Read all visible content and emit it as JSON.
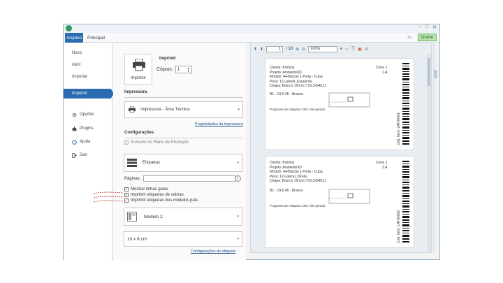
{
  "window": {
    "controls": [
      "–",
      "□",
      "✕"
    ]
  },
  "tabs": {
    "file_label": "Arquivo",
    "main_label": "Principal"
  },
  "status": {
    "online_label": "Online"
  },
  "sidebar": {
    "items": [
      {
        "label": "Novo"
      },
      {
        "label": "Abrir"
      },
      {
        "label": "Importar"
      },
      {
        "label": "Imprimir"
      },
      {
        "label": "Opções"
      },
      {
        "label": "Plugins"
      },
      {
        "label": "Ajuda"
      },
      {
        "label": "Sair"
      }
    ]
  },
  "print": {
    "heading": "Imprimir",
    "button_label": "Imprimir",
    "copies_label": "Cópias:",
    "copies_value": "1"
  },
  "printer": {
    "section_title": "Impressora",
    "selected": "Impressora - Área Técnica",
    "properties_link": "Propriedades da impressora"
  },
  "settings": {
    "section_title": "Configurações",
    "sumario_label": "Sumário do Plano de Produção",
    "type_selected": "Etiquetas",
    "paginas_label": "Páginas:",
    "info_symbol": "i",
    "checkboxes": [
      {
        "label": "Mostrar linhas guias",
        "checked": true
      },
      {
        "label": "Imprimir etiquetas de sobras",
        "checked": true
      },
      {
        "label": "Imprimir etiquetas dos módulos pais",
        "checked": true
      }
    ],
    "model_selected": "Modelo 2",
    "size_selected": "10 x 6 cm",
    "label_config_link": "Configurações de etiqueta"
  },
  "preview": {
    "page_current": "1",
    "page_total": "/ 18",
    "zoom": "100%",
    "labels": [
      {
        "lines": [
          "Cliente: Patrícia",
          "Projeto: Ambiente3D",
          "Módulo: 44-Balcão 1 Porta - Cuba",
          "Peça: 11-Lateral_Esquerda",
          "Chapa: Branco 15mm (719,3x549,1)"
        ],
        "corte": [
          "Corte 1",
          "1.A"
        ],
        "code_line": "B1 - 19-0.45 - Branco",
        "footer": "Programa de máquina CNC não gerado",
        "barcode_text": "Cód. Item: LAT00001"
      },
      {
        "lines": [
          "Cliente: Patrícia",
          "Projeto: Ambiente3D",
          "Módulo: 44-Balcão 1 Porta - Cuba",
          "Peça: 12-Lateral_Direita",
          "Chapa: Branco 15mm (719,3x549,1)"
        ],
        "corte": [
          "Corte 1",
          "2.A"
        ],
        "code_line": "B1 - 19-0.45 - Branco",
        "footer": "Programa de máquina CNC não gerado",
        "barcode_text": "Cód. Item: LAT00002"
      }
    ]
  }
}
